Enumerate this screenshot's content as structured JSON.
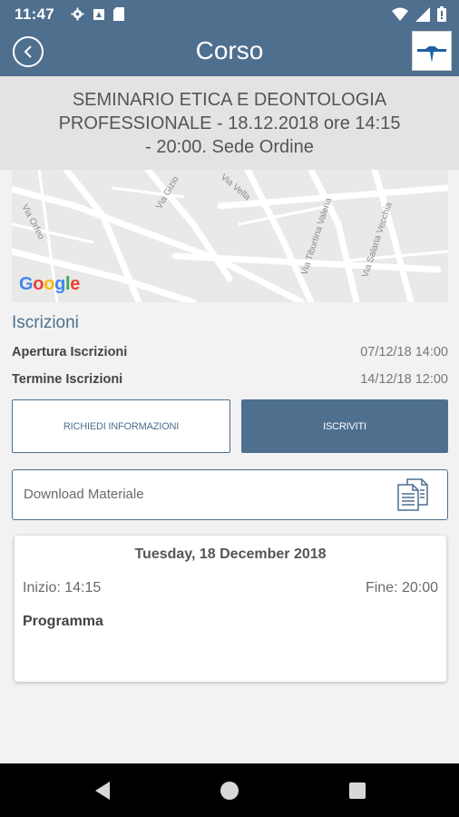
{
  "status_bar": {
    "time": "11:47",
    "left_icons": [
      "gear-icon",
      "screenshot-icon",
      "sd-card-icon"
    ],
    "right_icons": [
      "wifi-icon",
      "signal-icon",
      "battery-icon"
    ]
  },
  "app_bar": {
    "title": "Corso",
    "back_icon": "back-arrow-icon",
    "logo": "app-logo"
  },
  "course": {
    "title": "SEMINARIO ETICA E DEONTOLOGIA PROFESSIONALE - 18.12.2018 ore 14:15 - 20:00. Sede Ordine"
  },
  "map": {
    "street_labels": [
      "Via Orfeo",
      "Via Gizio",
      "Via Vella",
      "Via Tiburtina Valeria",
      "Via Salaria Vecchia"
    ],
    "attribution": "Google"
  },
  "registration": {
    "section_title": "Iscrizioni",
    "rows": [
      {
        "label": "Apertura Iscrizioni",
        "value": "07/12/18 14:00"
      },
      {
        "label": "Termine Iscrizioni",
        "value": "14/12/18 12:00"
      }
    ],
    "request_info_label": "RICHIEDI INFORMAZIONI",
    "subscribe_label": "ISCRIVITI"
  },
  "download": {
    "label": "Download Materiale",
    "icon": "document-icon"
  },
  "schedule": {
    "date": "Tuesday, 18 December 2018",
    "start": "Inizio: 14:15",
    "end": "Fine: 20:00",
    "program_label": "Programma"
  },
  "nav_bar": {
    "buttons": [
      "back-triangle-icon",
      "home-circle-icon",
      "recents-square-icon"
    ]
  },
  "colors": {
    "primary": "#4f6f8f",
    "title_band": "#e3e3e3",
    "background": "#f2f2f2"
  }
}
